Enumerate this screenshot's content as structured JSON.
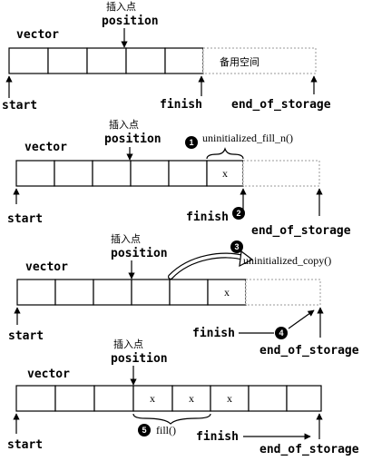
{
  "labels": {
    "vector": "vector",
    "insert_point": "插入点",
    "position": "position",
    "start": "start",
    "finish": "finish",
    "end_of_storage": "end_of_storage",
    "spare_space": "备用空间",
    "uninit_fill_n": "uninitialized_fill_n()",
    "uninit_copy": "uninitialized_copy()",
    "fill": "fill()",
    "x": "x"
  },
  "steps": {
    "s1": "1",
    "s2": "2",
    "s3": "3",
    "s4": "4",
    "s5": "5"
  }
}
